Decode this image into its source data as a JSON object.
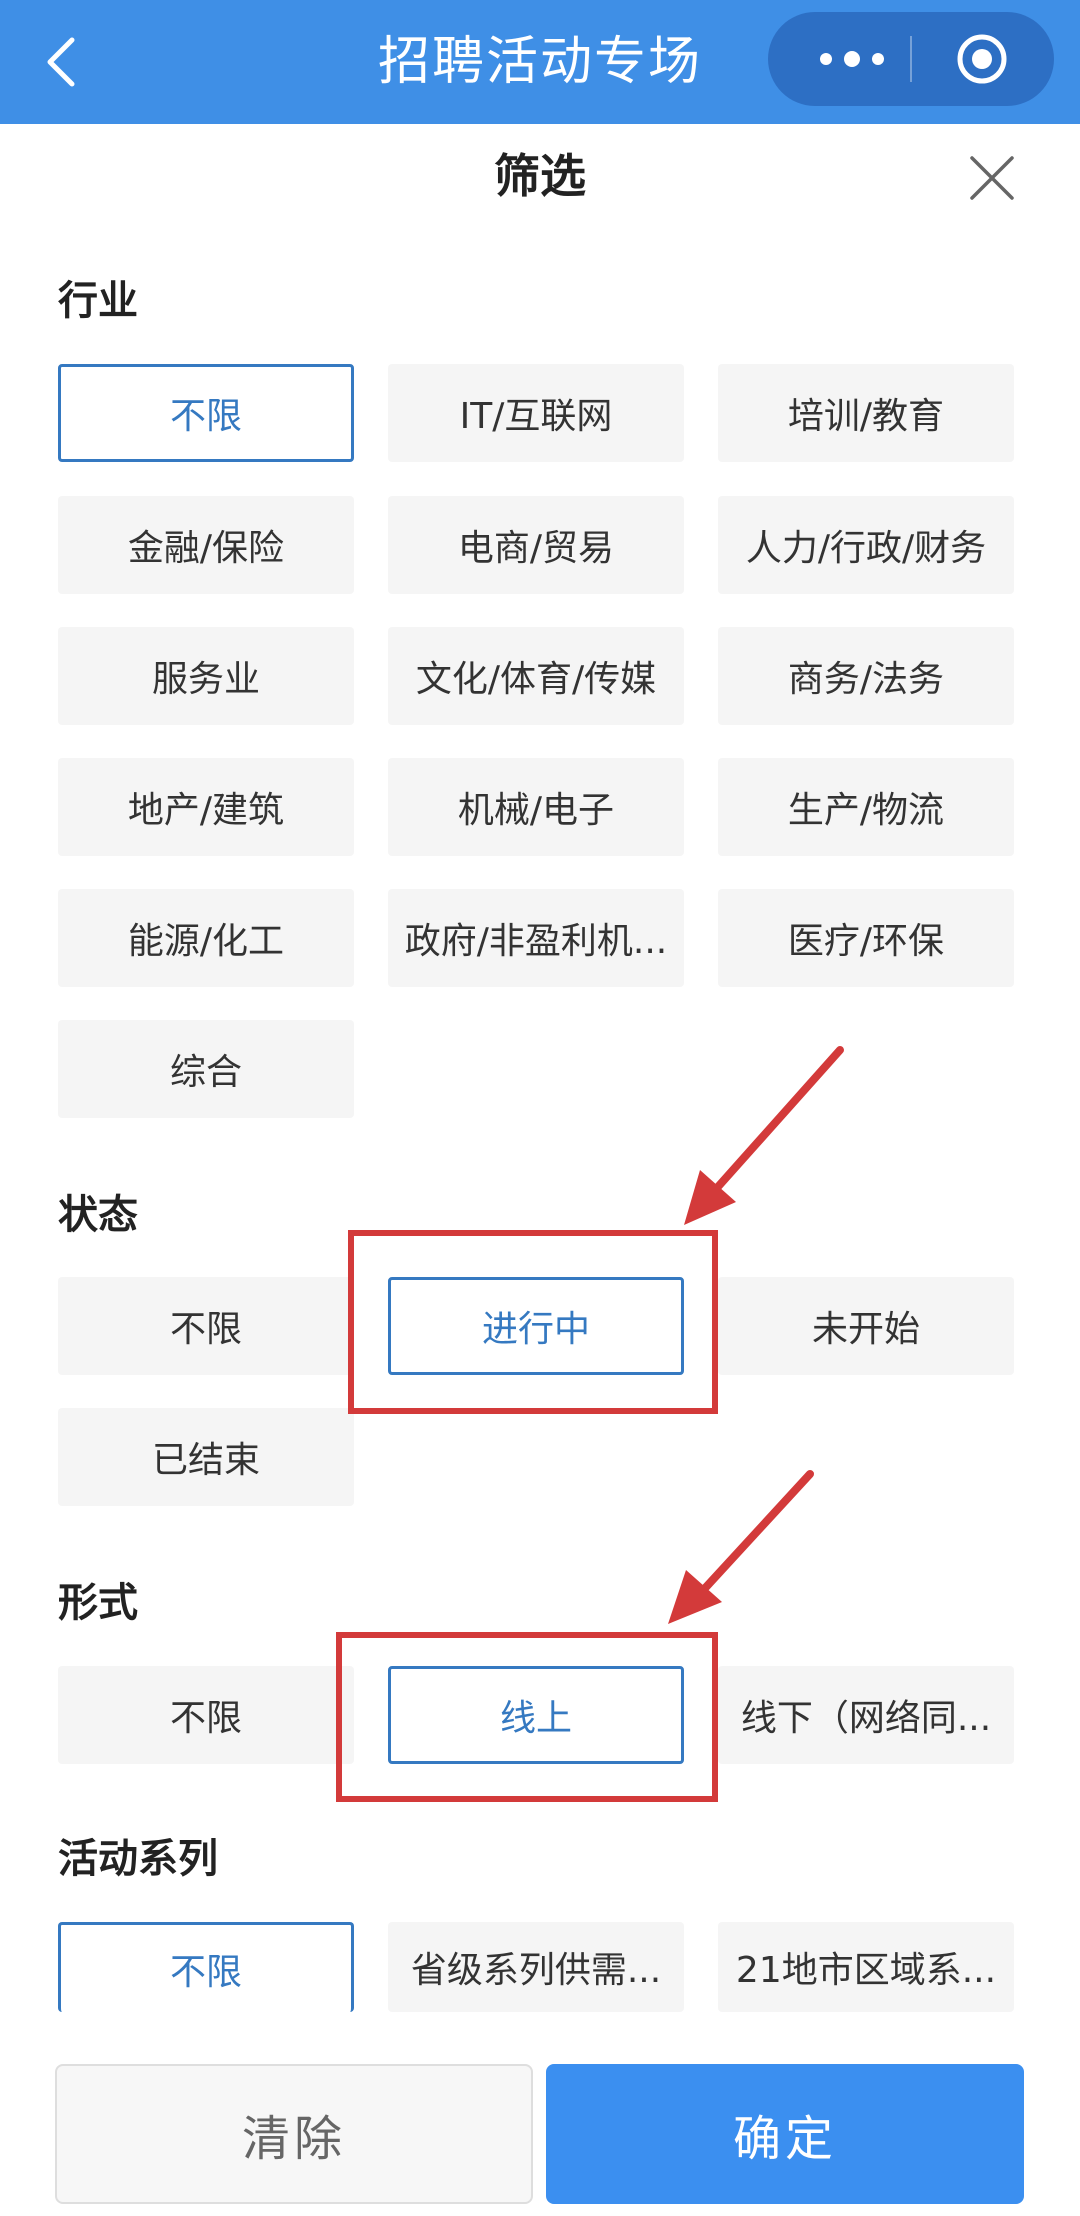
{
  "app": {
    "title": "招聘活动专场"
  },
  "panel": {
    "title": "筛选"
  },
  "industry": {
    "title": "行业",
    "options": [
      "不限",
      "IT/互联网",
      "培训/教育",
      "金融/保险",
      "电商/贸易",
      "人力/行政/财务",
      "服务业",
      "文化/体育/传媒",
      "商务/法务",
      "地产/建筑",
      "机械/电子",
      "生产/物流",
      "能源/化工",
      "政府/非盈利机...",
      "医疗/环保",
      "综合"
    ],
    "selected": "不限"
  },
  "status": {
    "title": "状态",
    "options": [
      "不限",
      "进行中",
      "未开始",
      "已结束"
    ],
    "selected": "进行中"
  },
  "format": {
    "title": "形式",
    "options": [
      "不限",
      "线上",
      "线下（网络同..."
    ],
    "selected": "线上"
  },
  "series": {
    "title": "活动系列",
    "options": [
      "不限",
      "省级系列供需...",
      "21地市区域系..."
    ],
    "selected": "不限"
  },
  "footer": {
    "clear_label": "清除",
    "confirm_label": "确定"
  },
  "colors": {
    "topbar": "#3f8fe6",
    "accent": "#3579c1",
    "confirm_button": "#3b8ff0",
    "annotation_red": "#d33a3a",
    "chip_background": "#f5f5f5"
  }
}
